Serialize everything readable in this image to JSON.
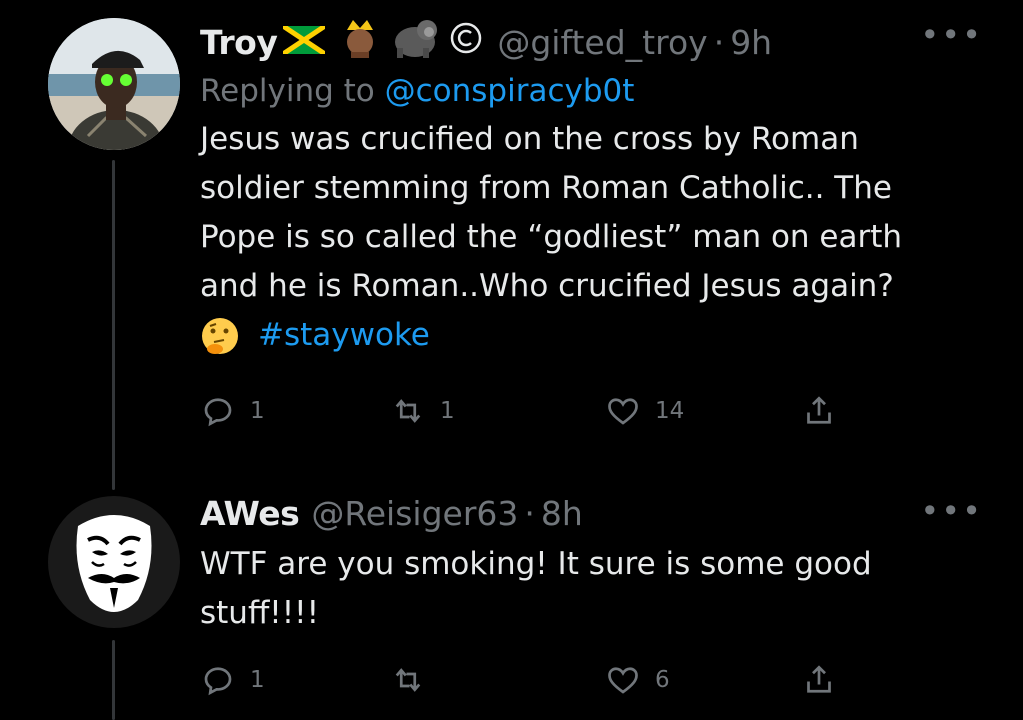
{
  "tweets": [
    {
      "name": "Troy",
      "handle": "@gifted_troy",
      "separator": "·",
      "time": "9h",
      "replying_prefix": "Replying to ",
      "replying_to": "@conspiracyb0t",
      "text_lines": [
        "Jesus was crucified on the cross by Roman",
        "soldier stemming from Roman Catholic.. The",
        "Pope is so called the “godliest” man on earth",
        "and he is Roman..Who crucified Jesus again?"
      ],
      "hashtag": "#staywoke",
      "replies": "1",
      "retweets": "1",
      "likes": "14"
    },
    {
      "name": "AWes",
      "handle": "@Reisiger63",
      "separator": "·",
      "time": "8h",
      "text_lines": [
        "WTF are you smoking! It sure is some good",
        "stuff!!!!"
      ],
      "replies": "1",
      "retweets": "",
      "likes": "6"
    }
  ],
  "more_label": "•••",
  "name_badges": [
    "jamaica-flag",
    "king-emoji",
    "gorilla-emoji",
    "copyright-symbol"
  ],
  "colors": {
    "background": "#000000",
    "text": "#e7e9ea",
    "muted": "#71767b",
    "link": "#1d9bf0"
  }
}
